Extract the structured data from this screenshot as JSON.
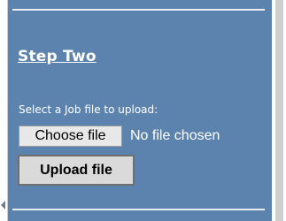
{
  "step": {
    "title": "Step Two",
    "upload_label": "Select a Job file to upload:",
    "choose_button_label": "Choose file",
    "file_status": "No file chosen",
    "upload_button_label": "Upload file"
  },
  "colors": {
    "panel_background": "#5c83ad",
    "panel_text": "#ffffff",
    "button_background": "#e8e8e8"
  }
}
